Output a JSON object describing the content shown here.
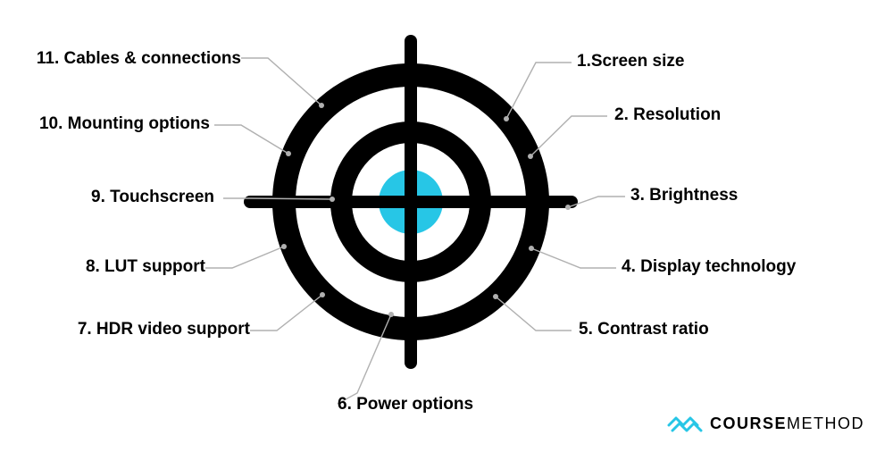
{
  "labels": {
    "l1": "1.Screen size",
    "l2": "2. Resolution",
    "l3": "3. Brightness",
    "l4": "4. Display technology",
    "l5": "5. Contrast ratio",
    "l6": "6. Power options",
    "l7": "7. HDR video support",
    "l8": "8. LUT support",
    "l9": "9. Touchscreen",
    "l10": "10. Mounting options",
    "l11": "11. Cables & connections"
  },
  "brand": {
    "first": "COURSE",
    "second": "METHOD"
  },
  "colors": {
    "accent": "#27c6e6",
    "target": "#000000",
    "leader": "#b0b0b0"
  }
}
